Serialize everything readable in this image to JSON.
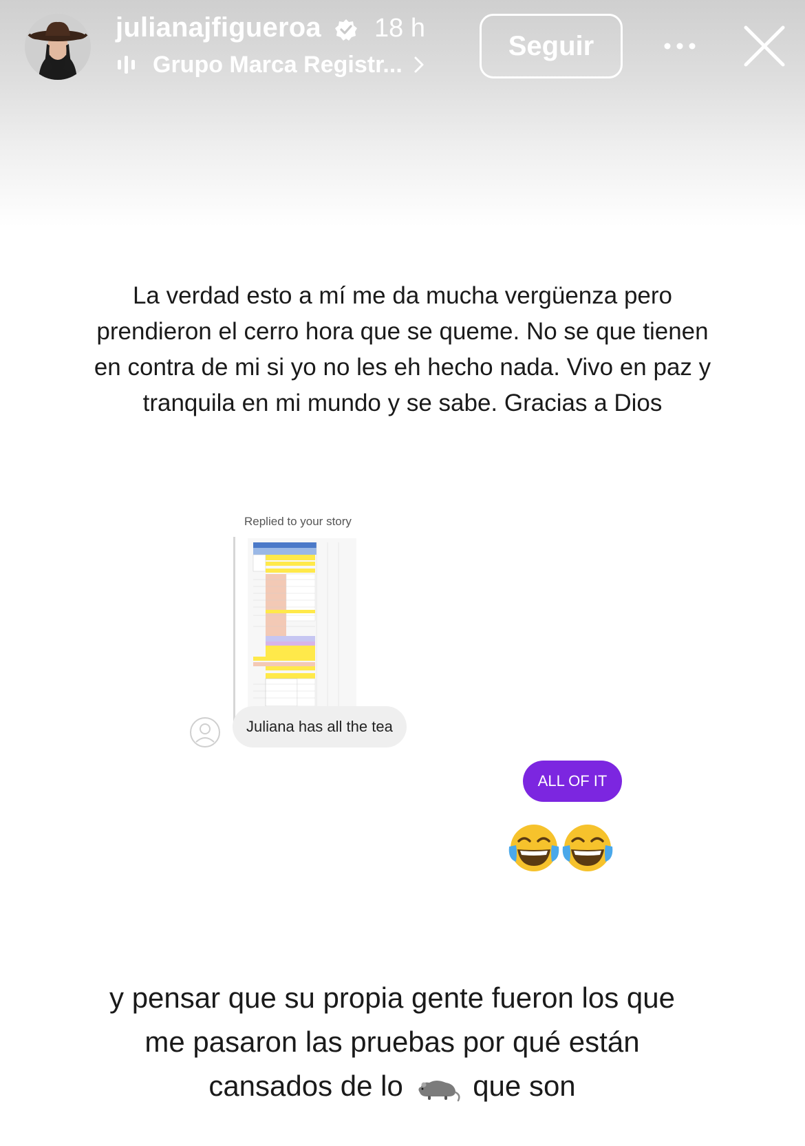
{
  "header": {
    "username": "julianajfigueroa",
    "time_ago": "18 h",
    "audio_label": "Grupo Marca Registr...",
    "follow_label": "Seguir",
    "icons": {
      "avatar": "profile-avatar",
      "verified": "verified-badge-icon",
      "audio": "audio-bars-icon",
      "chevron": "chevron-right-icon",
      "more": "more-options-icon",
      "close": "close-icon"
    }
  },
  "story": {
    "top_caption_lines": [
      "La verdad esto a mí me da mucha vergüenza pero",
      "prendieron el cerro hora que se queme. No se que tienen",
      "en contra de mi si yo no les eh hecho nada. Vivo en paz y",
      "tranquila en mi mundo y se sabe. Gracias a Dios"
    ],
    "chat": {
      "replied_label": "Replied to your story",
      "incoming_message": "Juliana has all the tea",
      "outgoing_message": "ALL OF IT",
      "reaction_emoji": [
        "laughing-emoji",
        "laughing-emoji"
      ],
      "outgoing_color": "#7c26e0"
    },
    "bottom_caption": {
      "line1": "y pensar que su propia gente fueron los que",
      "line2": "me pasaron las pruebas por qué están",
      "line3_before": "cansados de lo",
      "line3_icon": "rat-emoji",
      "line3_after": "que son"
    }
  }
}
